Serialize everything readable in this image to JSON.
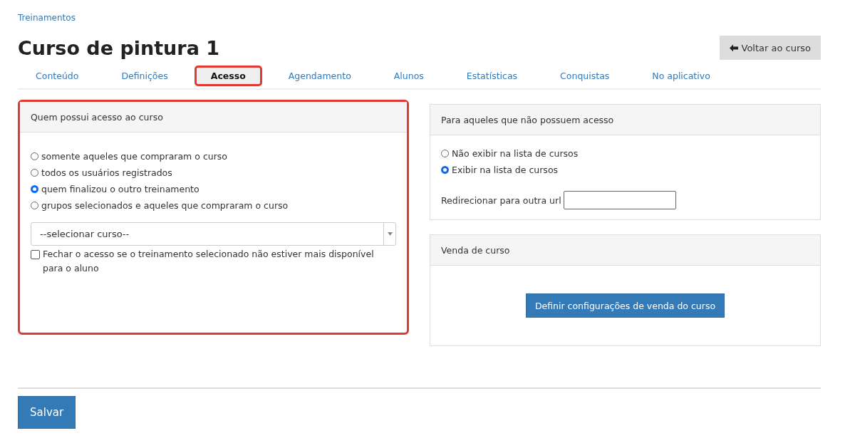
{
  "breadcrumb": "Treinamentos",
  "title": "Curso de pintura 1",
  "back_button": "Voltar ao curso",
  "tabs": [
    {
      "label": "Conteúdo",
      "selected": false
    },
    {
      "label": "Definições",
      "selected": false
    },
    {
      "label": "Acesso",
      "selected": true
    },
    {
      "label": "Agendamento",
      "selected": false
    },
    {
      "label": "Alunos",
      "selected": false
    },
    {
      "label": "Estatísticas",
      "selected": false
    },
    {
      "label": "Conquistas",
      "selected": false
    },
    {
      "label": "No aplicativo",
      "selected": false
    }
  ],
  "access_panel": {
    "title": "Quem possui acesso ao curso",
    "highlighted": true,
    "options": [
      {
        "label": "somente aqueles que compraram o curso",
        "selected": false
      },
      {
        "label": "todos os usuários registrados",
        "selected": false
      },
      {
        "label": "quem finalizou o outro treinamento",
        "selected": true
      },
      {
        "label": "grupos selecionados e aqueles que compraram o curso",
        "selected": false
      }
    ],
    "course_select": {
      "value": "--selecionar curso--"
    },
    "close_access": {
      "label": "Fechar o acesso se o treinamento selecionado não estiver mais disponível para o aluno",
      "checked": false
    }
  },
  "no_access_panel": {
    "title": "Para aqueles que não possuem acesso",
    "options": [
      {
        "label": "Não exibir na lista de cursos",
        "selected": false
      },
      {
        "label": "Exibir na lista de cursos",
        "selected": true
      }
    ],
    "redirect_label": "Redirecionar para outra url"
  },
  "sale_panel": {
    "title": "Venda de curso",
    "button": "Definir configurações de venda do curso"
  },
  "save_button": "Salvar"
}
